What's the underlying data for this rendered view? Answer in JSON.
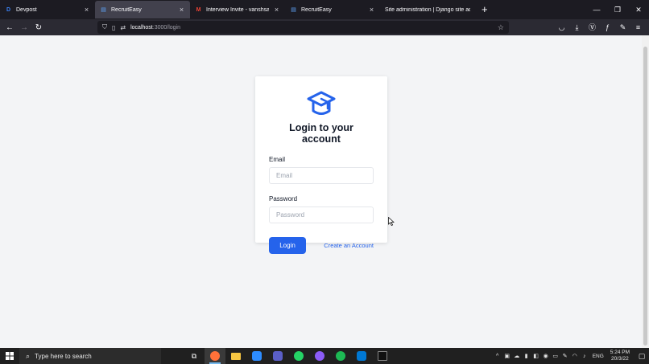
{
  "browser": {
    "tabs": [
      {
        "favicon": "D",
        "title": "Devpost",
        "active": false,
        "favicon_color": "#3b82f6"
      },
      {
        "favicon": "▤",
        "title": "RecruitEasy",
        "active": true,
        "favicon_color": "#60a5fa"
      },
      {
        "favicon": "M",
        "title": "Interview Invite - vanshsachdev",
        "active": false,
        "favicon_color": "#ea4335"
      },
      {
        "favicon": "▤",
        "title": "RecruitEasy",
        "active": false,
        "favicon_color": "#60a5fa"
      },
      {
        "favicon": "",
        "title": "Site administration | Django site ad",
        "active": false,
        "favicon_color": "#60a5fa"
      }
    ],
    "new_tab_label": "+",
    "close_glyph": "×",
    "url_host": "localhost",
    "url_rest": ":3000/login"
  },
  "page": {
    "heading": "Login to your account",
    "email_label": "Email",
    "email_placeholder": "Email",
    "email_value": "",
    "password_label": "Password",
    "password_placeholder": "Password",
    "password_value": "",
    "login_button": "Login",
    "create_account_link": "Create an Account",
    "brand_color": "#2563eb"
  },
  "taskbar": {
    "search_placeholder": "Type here to search",
    "language": "ENG",
    "time": "5:24 PM",
    "date": "20/3/22"
  }
}
